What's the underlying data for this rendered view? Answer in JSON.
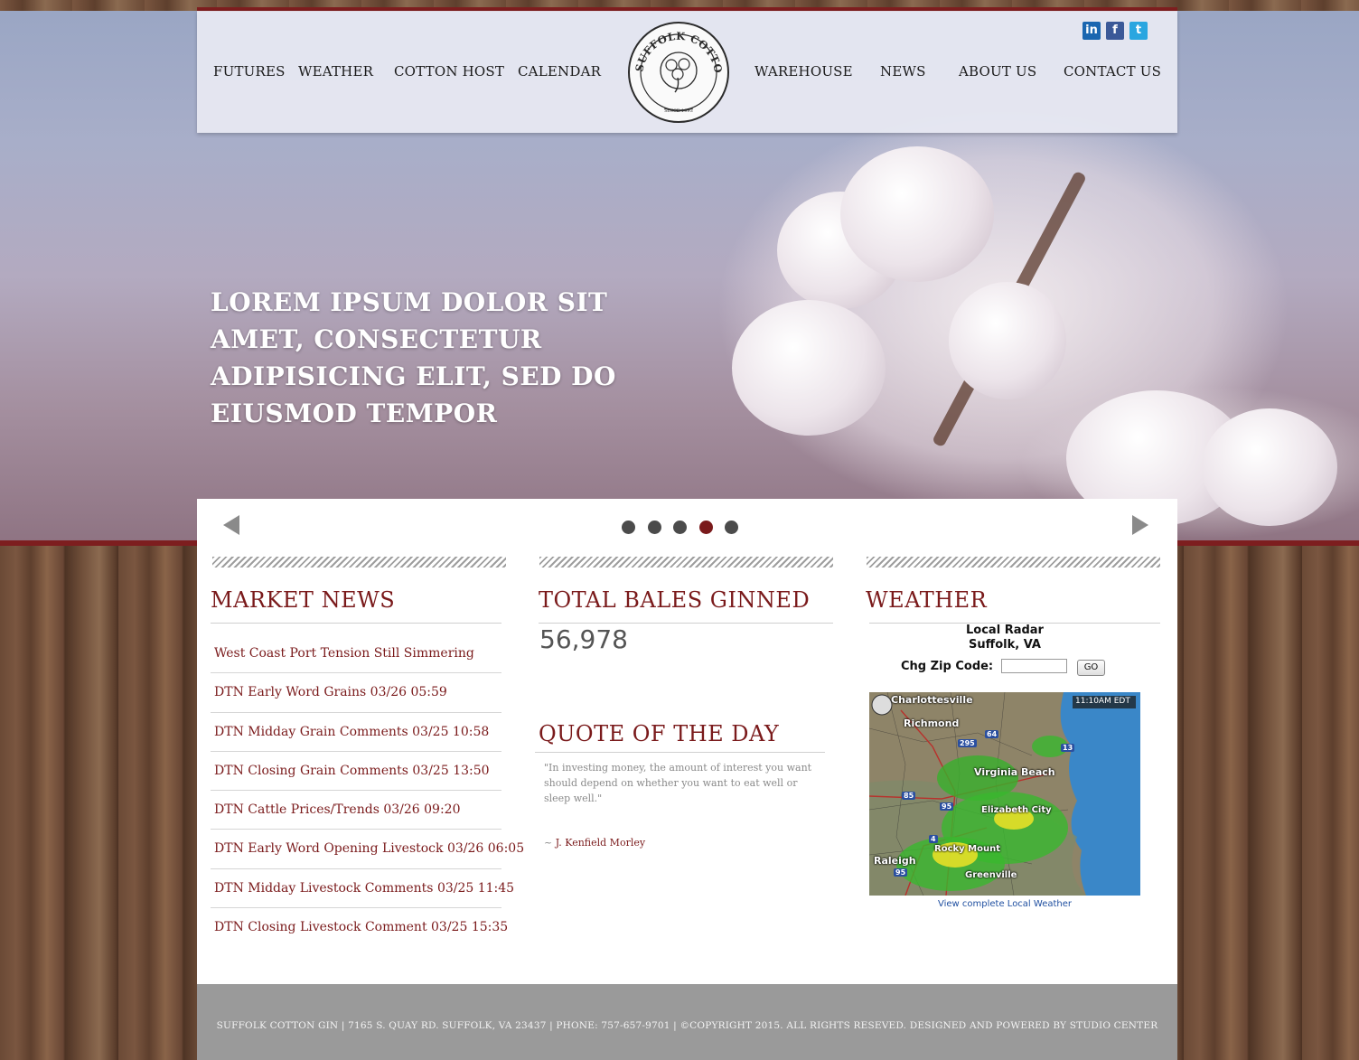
{
  "nav": {
    "left": [
      "FUTURES",
      "WEATHER",
      "COTTON HOST",
      "CALENDAR"
    ],
    "right": [
      "WAREHOUSE",
      "NEWS",
      "ABOUT US",
      "CONTACT US"
    ]
  },
  "logo": {
    "name": "SUFFOLK COTTON GIN",
    "since": "SINCE 1993"
  },
  "social": [
    {
      "icon": "linkedin-icon",
      "glyph": "in",
      "color": "#1a66b0"
    },
    {
      "icon": "facebook-icon",
      "glyph": "f",
      "color": "#3b5998"
    },
    {
      "icon": "twitter-icon",
      "glyph": "t",
      "color": "#2aa6e0"
    }
  ],
  "hero": {
    "caption": "LOREM IPSUM DOLOR SIT AMET, CONSECTETUR ADIPISICING ELIT, SED DO EIUSMOD TEMPOR"
  },
  "slider": {
    "slides": 5,
    "active_index": 3,
    "active_color": "#7a1a1b",
    "dot_color": "#4b4b4b"
  },
  "market_news": {
    "title": "MARKET NEWS",
    "items": [
      "West Coast Port Tension Still Simmering",
      "DTN Early Word Grains 03/26 05:59",
      "DTN Midday Grain Comments 03/25 10:58",
      "DTN Closing Grain Comments 03/25 13:50",
      "DTN Cattle Prices/Trends 03/26 09:20",
      "DTN Early Word Opening Livestock 03/26 06:05",
      "DTN Midday Livestock Comments 03/25 11:45",
      "DTN Closing Livestock Comment 03/25 15:35"
    ]
  },
  "bales": {
    "title": "TOTAL BALES GINNED",
    "value": "56,978"
  },
  "quote": {
    "title": "QUOTE OF THE DAY",
    "text": "\"In investing money, the amount of interest you want should depend on whether you want to eat well or sleep well.\"",
    "prefix": "~ ",
    "author": "J. Kenfield Morley"
  },
  "weather": {
    "title": "WEATHER",
    "radar_title": "Local Radar",
    "location": "Suffolk, VA",
    "zip_label": "Chg Zip Code:",
    "zip_value": "",
    "go_label": "GO",
    "link": "View complete Local Weather",
    "map": {
      "timestamp": "11:10AM EDT",
      "cities": [
        "Charlottesville",
        "Richmond",
        "Virginia Beach",
        "Elizabeth City",
        "Rocky Mount",
        "Raleigh",
        "Greenville"
      ],
      "routes": [
        "295",
        "64",
        "13",
        "85",
        "95",
        "95",
        "4"
      ]
    }
  },
  "footer": {
    "text": "SUFFOLK COTTON GIN  |  7165 S. QUAY RD. SUFFOLK, VA 23437  |  PHONE: 757-657-9701  |  ©COPYRIGHT 2015. ALL RIGHTS RESEVED. DESIGNED AND POWERED BY STUDIO CENTER"
  },
  "colors": {
    "accent": "#7a1a1b",
    "footer_bg": "#9a9a9a",
    "header_bg": "#e8eaf3"
  }
}
